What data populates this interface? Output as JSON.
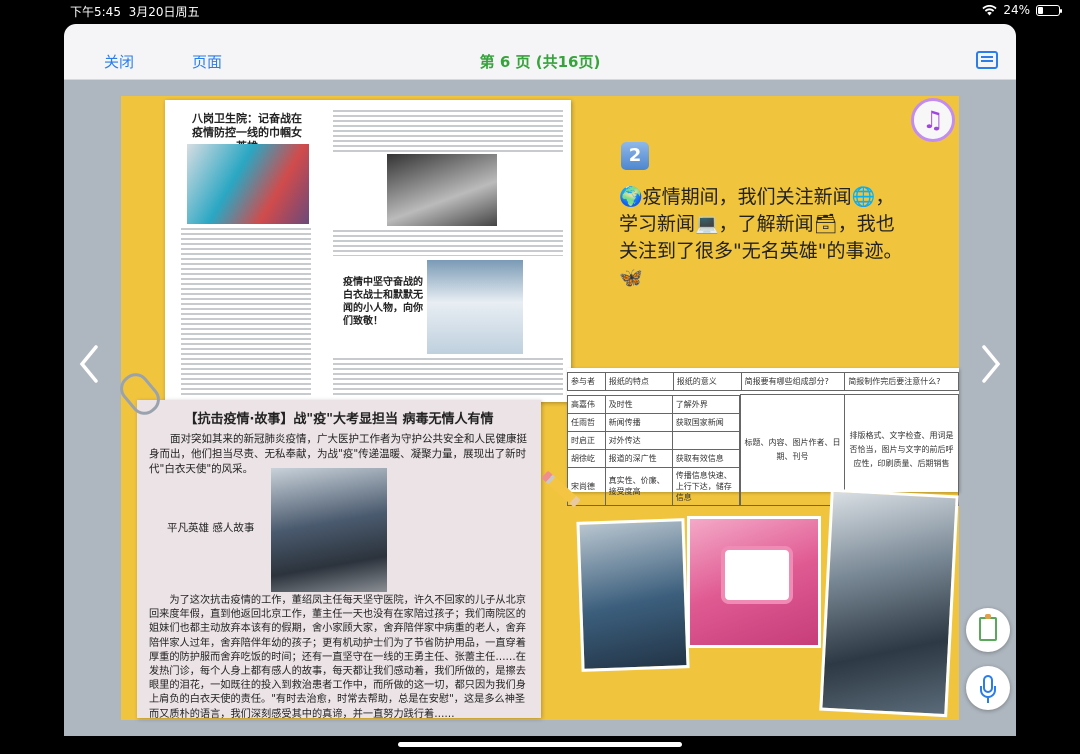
{
  "status_bar": {
    "time": "下午5:45",
    "date": "3月20日周五",
    "battery": "24%"
  },
  "toolbar": {
    "close_label": "关闭",
    "pages_label": "页面",
    "title": "第 6 页 (共16页)"
  },
  "page": {
    "badge_number": "2",
    "main_text": "🌍疫情期间，我们关注新闻🌐，学习新闻💻，了解新闻🗃，我也关注到了很多\"无名英雄\"的事迹。🦋",
    "clipping_top": {
      "headline": "八岗卫生院：记奋战在疫情防控一线的巾帼女英雄",
      "sub_headline": "疫情中坚守奋战的白衣战士和默默无闻的小人物，向你们致敬！"
    },
    "clipping_story": {
      "title": "【抗击疫情·故事】战\"疫\"大考显担当 病毒无情人有情",
      "intro": "面对突如其来的新冠肺炎疫情，广大医护工作者为守护公共安全和人民健康挺身而出，他们担当尽责、无私奉献，为战\"疫\"传递温暖、凝聚力量，展现出了新时代\"白衣天使\"的风采。",
      "caption": "平凡英雄 感人故事",
      "body": "为了这次抗击疫情的工作，董绍凤主任每天坚守医院，许久不回家的儿子从北京回来度年假，直到他返回北京工作，董主任一天也没有在家陪过孩子；我们南院区的姐妹们也都主动放弃本该有的假期，舍小家顾大家，舍弃陪伴家中病重的老人，舍弃陪伴家人过年，舍弃陪伴年幼的孩子；更有机动护士们为了节省防护用品，一直穿着厚重的防护服而舍弃吃饭的时间；还有一直坚守在一线的王勇主任、张蕾主任……在发热门诊，每个人身上都有感人的故事，每天都让我们感动着，我们所做的，是擦去眼里的泪花，一如既往的投入到救治患者工作中，而所做的这一切，都只因为我们身上肩负的白衣天使的责任。\"有时去治愈，时常去帮助，总是在安慰\"，这是多么神圣而又质朴的语言，我们深刻感受其中的真谛，并一直努力践行着……"
    },
    "table": {
      "headers": [
        "参与者",
        "报纸的特点",
        "报纸的意义",
        "简报要有哪些组成部分?",
        "简报制作完后要注意什么?"
      ],
      "rows": [
        [
          "高嘉伟",
          "及时性",
          "了解外界"
        ],
        [
          "任雨哲",
          "新闻传播",
          "获取国家新闻"
        ],
        [
          "时启正",
          "对外传达",
          ""
        ],
        [
          "胡徐屹",
          "报道的深广性",
          "获取有效信息"
        ],
        [
          "宋尚德",
          "真实性、价廉、接受度高",
          "传播信息快速、上行下达，储存信息"
        ]
      ],
      "col4": "标题、内容、图片作者、日期、刊号",
      "col5": "排版格式、文字检查、用词是否恰当，图片与文字的前后呼应性，印刷质量、后期销售",
      "add_button": "+"
    }
  }
}
